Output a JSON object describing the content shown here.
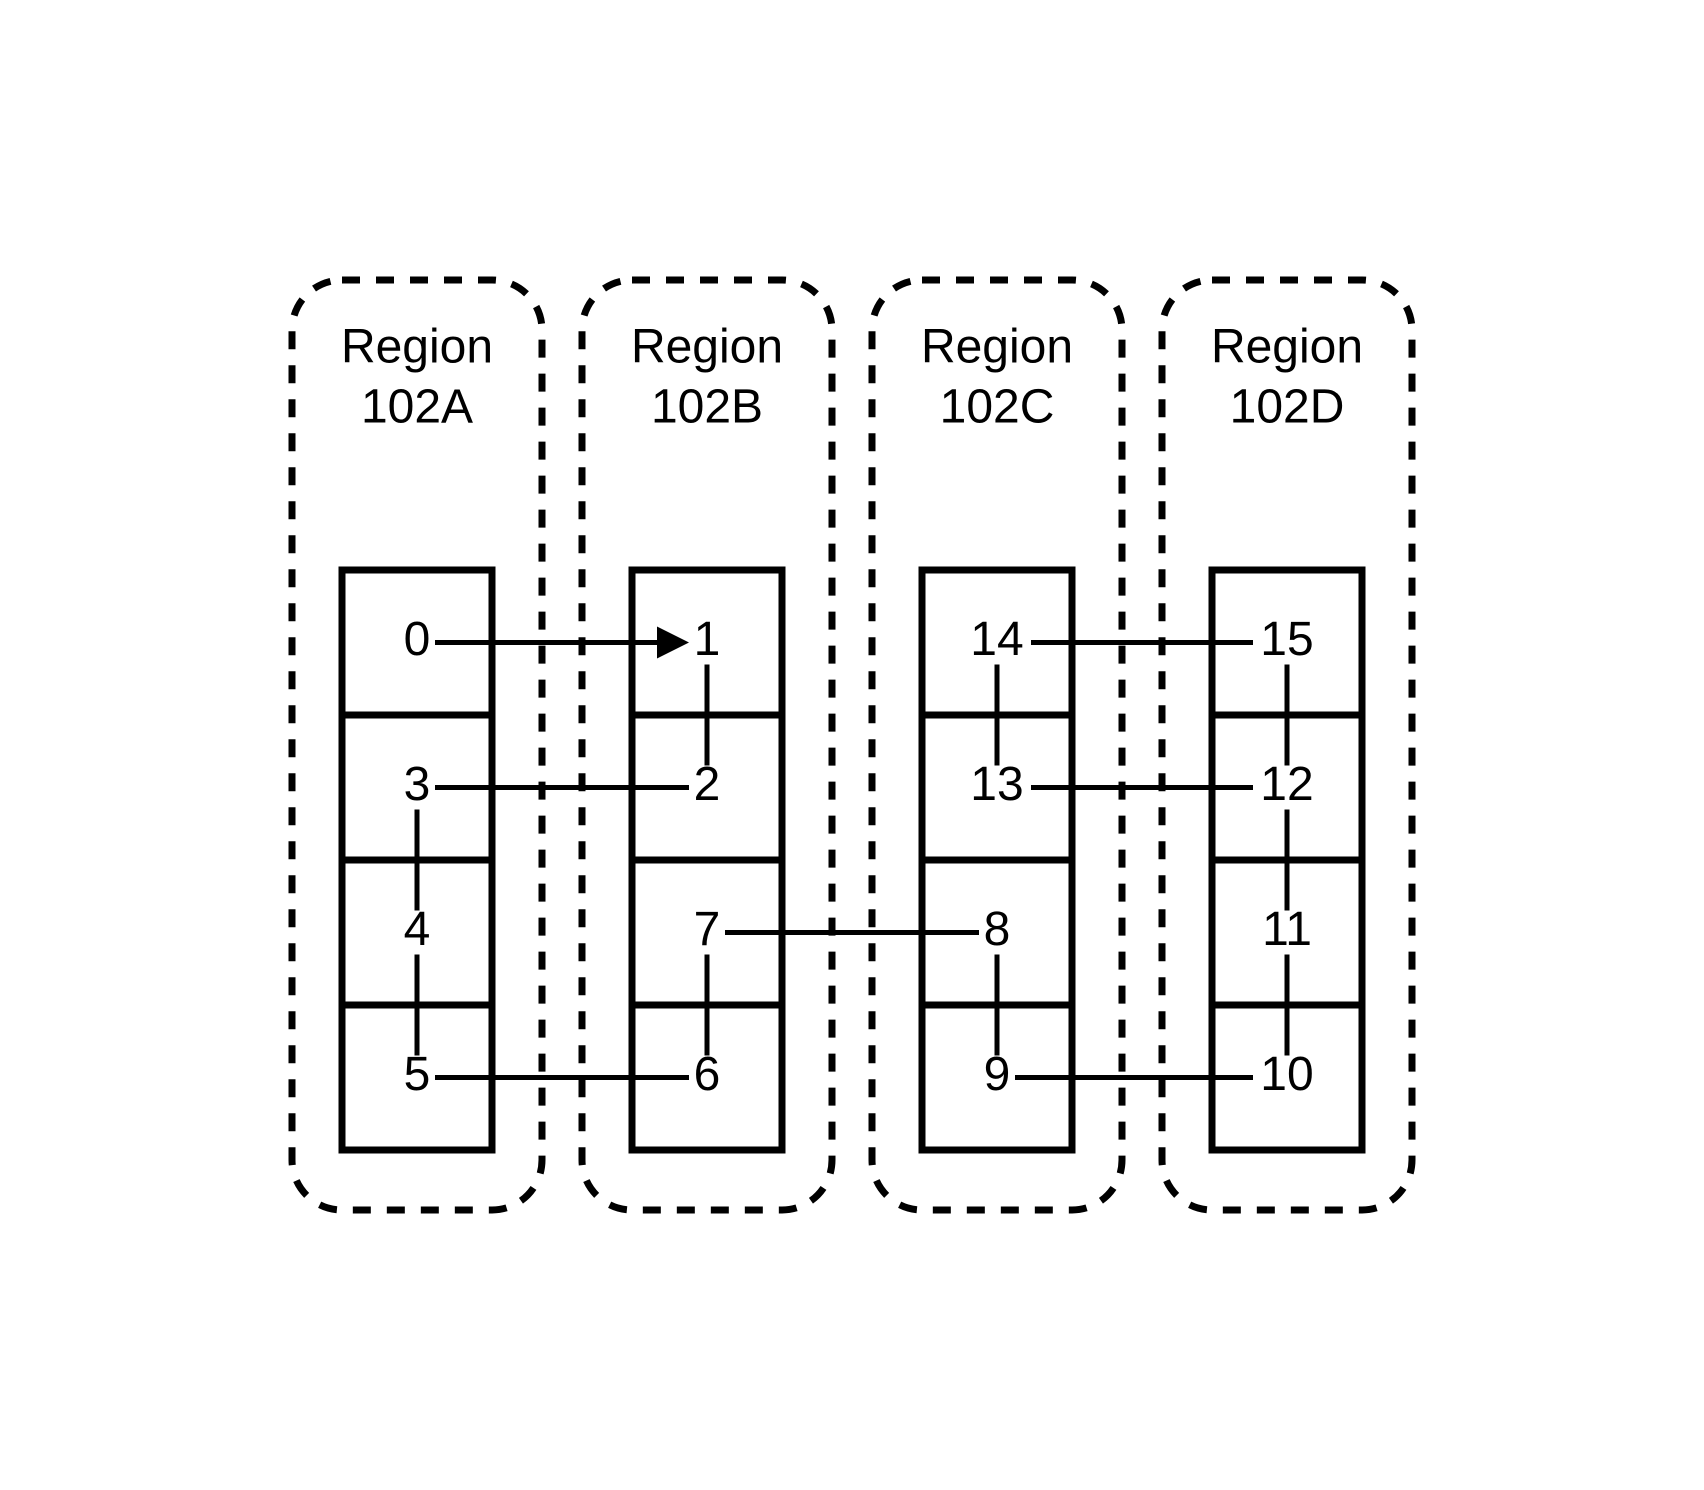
{
  "regions": [
    {
      "title1": "Region",
      "title2": "102A",
      "cells": [
        "0",
        "3",
        "4",
        "5"
      ]
    },
    {
      "title1": "Region",
      "title2": "102B",
      "cells": [
        "1",
        "2",
        "7",
        "6"
      ]
    },
    {
      "title1": "Region",
      "title2": "102C",
      "cells": [
        "14",
        "13",
        "8",
        "9"
      ]
    },
    {
      "title1": "Region",
      "title2": "102D",
      "cells": [
        "15",
        "12",
        "11",
        "10"
      ]
    }
  ],
  "arrow_from": "0",
  "arrow_to": "1",
  "links": {
    "horizontal": [
      [
        "0",
        "1"
      ],
      [
        "3",
        "2"
      ],
      [
        "7",
        "8"
      ],
      [
        "5",
        "6"
      ],
      [
        "14",
        "15"
      ],
      [
        "13",
        "12"
      ],
      [
        "9",
        "10"
      ]
    ],
    "vertical": [
      [
        "1",
        "2"
      ],
      [
        "3",
        "4"
      ],
      [
        "4",
        "5"
      ],
      [
        "7",
        "6"
      ],
      [
        "14",
        "13"
      ],
      [
        "8",
        "9"
      ],
      [
        "15",
        "12"
      ],
      [
        "12",
        "11"
      ],
      [
        "11",
        "10"
      ]
    ]
  }
}
